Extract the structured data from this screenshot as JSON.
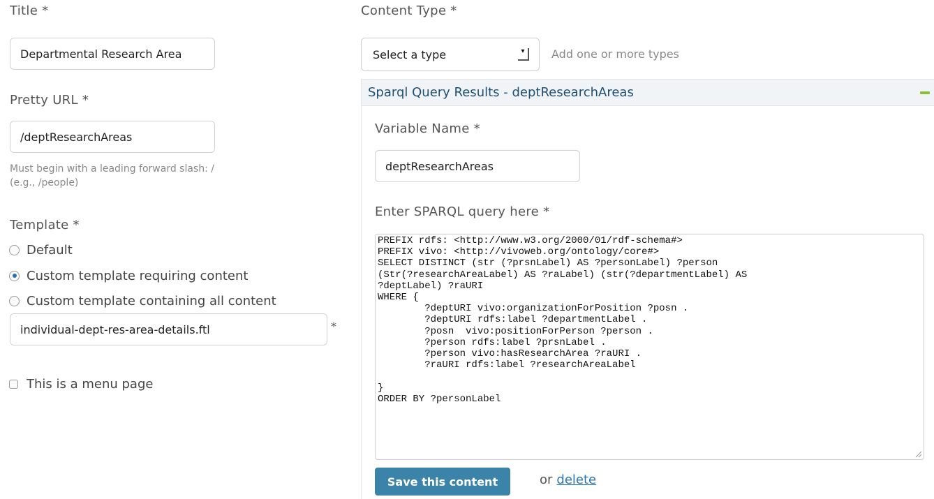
{
  "title_field": {
    "label": "Title *",
    "value": "Departmental Research Area"
  },
  "pretty_url_field": {
    "label": "Pretty URL *",
    "value": "/deptResearchAreas",
    "hint_line1": "Must begin with a leading forward slash: /",
    "hint_line2": "(e.g., /people)"
  },
  "template_field": {
    "label": "Template *",
    "options": [
      {
        "label": "Default",
        "checked": false
      },
      {
        "label": "Custom template requiring content",
        "checked": true
      },
      {
        "label": "Custom template containing all content",
        "checked": false
      }
    ],
    "custom_template_value": "individual-dept-res-area-details.ftl",
    "required_marker": "*"
  },
  "menu_page": {
    "label": "This is a menu page",
    "checked": false
  },
  "content_type": {
    "label": "Content Type *",
    "select_value": "Select a type",
    "hint": "Add one or more types"
  },
  "panel": {
    "title": "Sparql Query Results - deptResearchAreas",
    "variable_name_label": "Variable Name *",
    "variable_name_value": "deptResearchAreas",
    "sparql_label": "Enter SPARQL query here *",
    "sparql_query": "PREFIX rdfs: <http://www.w3.org/2000/01/rdf-schema#>\nPREFIX vivo: <http://vivoweb.org/ontology/core#>\nSELECT DISTINCT (str (?prsnLabel) AS ?personLabel) ?person\n(Str(?researchAreaLabel) AS ?raLabel) (str(?departmentLabel) AS\n?deptLabel) ?raURI\nWHERE {\n        ?deptURI vivo:organizationForPosition ?posn .\n        ?deptURI rdfs:label ?departmentLabel .\n        ?posn  vivo:positionForPerson ?person .\n        ?person rdfs:label ?prsnLabel .\n        ?person vivo:hasResearchArea ?raURI .\n        ?raURI rdfs:label ?researchAreaLabel\n\n}\nORDER BY ?personLabel",
    "save_label": "Save this content",
    "or_text": "or",
    "delete_label": "delete"
  },
  "colors": {
    "accent": "#3c83aa",
    "panel_title": "#1f4f72",
    "link": "#2a77b8",
    "collapse": "#8bbf3a"
  }
}
